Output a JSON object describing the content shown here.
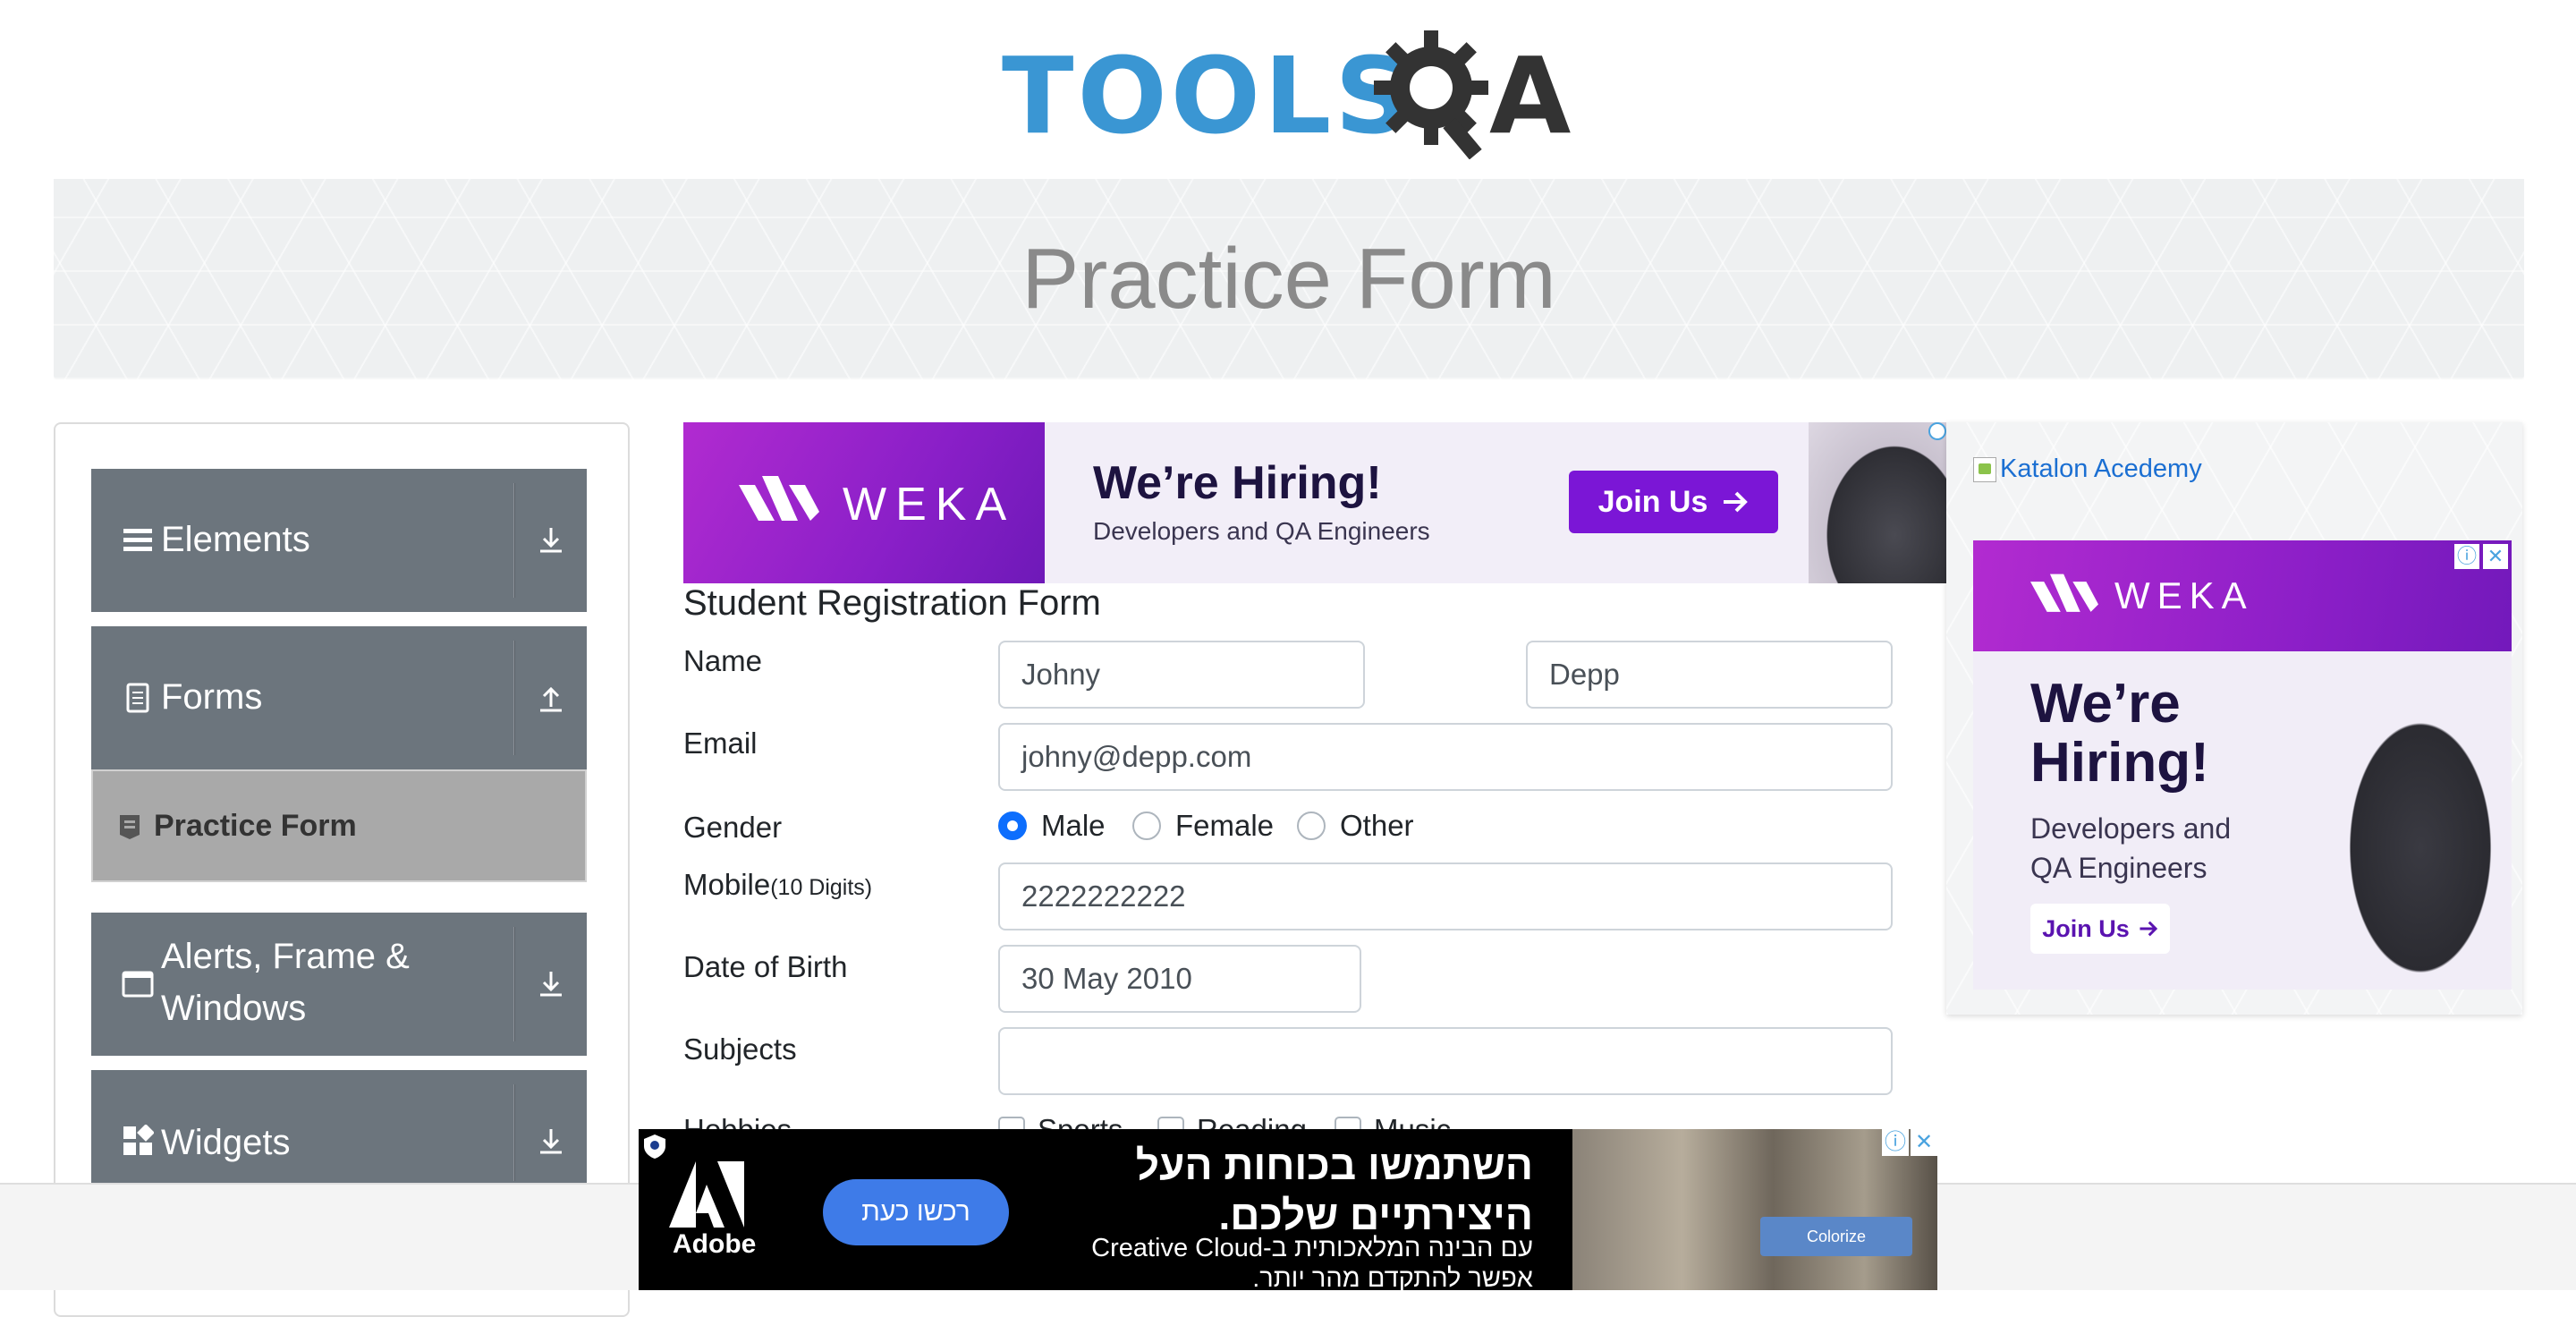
{
  "logo": {
    "text": "TOOLS",
    "letter": "A"
  },
  "banner": {
    "title": "Practice Form"
  },
  "sidebar": {
    "groups": [
      {
        "label": "Elements",
        "icon": "list-icon",
        "arrow": "download-arrow-icon"
      },
      {
        "label": "Forms",
        "icon": "document-icon",
        "arrow": "upload-arrow-icon"
      },
      {
        "label": "Alerts, Frame & Windows",
        "icon": "window-icon",
        "arrow": "download-arrow-icon"
      },
      {
        "label": "Widgets",
        "icon": "widgets-icon",
        "arrow": "download-arrow-icon"
      }
    ],
    "active_item": {
      "label": "Practice Form",
      "icon": "form-icon"
    }
  },
  "ad_top": {
    "brand": "WEKA",
    "headline": "We’re Hiring!",
    "subline": "Developers and QA Engineers",
    "cta": "Join Us"
  },
  "side_ad": {
    "image_alt": "Katalon Acedemy",
    "brand": "WEKA",
    "headline": "We’re Hiring!",
    "subline_1": "Developers and",
    "subline_2": "QA Engineers",
    "cta": "Join Us"
  },
  "form": {
    "title": "Student Registration Form",
    "name_label": "Name",
    "first_name": "Johny",
    "last_name": "Depp",
    "email_label": "Email",
    "email": "johny@depp.com",
    "gender_label": "Gender",
    "gender_options": [
      "Male",
      "Female",
      "Other"
    ],
    "gender_selected": "Male",
    "mobile_label": "Mobile",
    "mobile_hint": "(10 Digits)",
    "mobile": "2222222222",
    "dob_label": "Date of Birth",
    "dob": "30 May 2010",
    "subjects_label": "Subjects",
    "subjects": "",
    "hobbies_label": "Hobbies",
    "hobbies": [
      "Sports",
      "Reading",
      "Music"
    ]
  },
  "adobe_ad": {
    "brand": "Adobe",
    "cta": "רכשו כעת",
    "headline_1": "השתמשו בכוחות העל",
    "headline_2": "היצירתיים שלכם.",
    "sub_1": "עם הבינה המלאכותית ב-Creative Cloud",
    "sub_2": "אפשר להתקדם מהר יותר.",
    "photo_button": "Colorize"
  },
  "colors": {
    "menu_bg": "#6c757d",
    "active_bg": "#a9a9a9",
    "logo_blue": "#3a96d3",
    "radio_blue": "#0d6efd",
    "weka_purple": "#8a1fc8"
  }
}
